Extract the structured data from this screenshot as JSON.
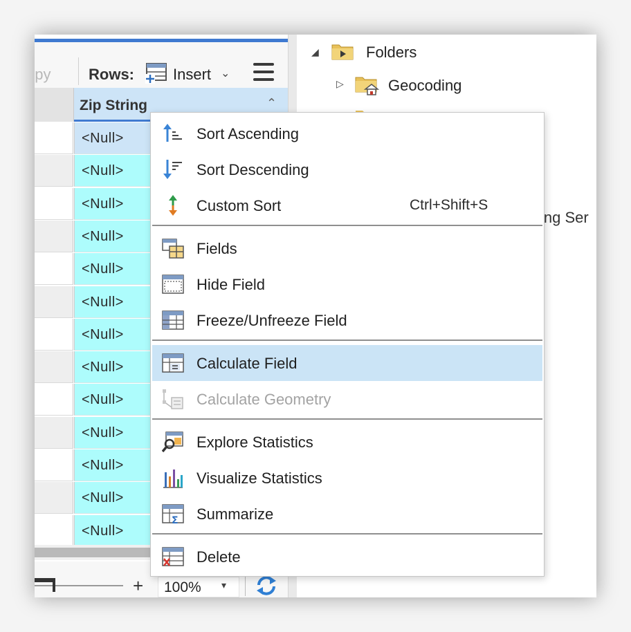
{
  "toolbar": {
    "copy_label": "opy",
    "rows_label": "Rows:",
    "insert_label": "Insert",
    "insert_arrow": "⌄"
  },
  "table": {
    "column_header": "Zip String",
    "header_chevron": "⌃",
    "cells": [
      "<Null>",
      "<Null>",
      "<Null>",
      "<Null>",
      "<Null>",
      "<Null>",
      "<Null>",
      "<Null>",
      "<Null>",
      "<Null>",
      "<Null>",
      "<Null>",
      "<Null>"
    ]
  },
  "zoom": {
    "plus": "+",
    "value": "100%",
    "arrow": "▾"
  },
  "catalog": {
    "expand_folders": "◢",
    "folders_label": "Folders",
    "expand_geocoding": "▷",
    "geocoding_label": "Geocoding",
    "cut_text": "ing Ser"
  },
  "menu": {
    "items": [
      {
        "label": "Sort Ascending",
        "icon": "sort-ascending-icon"
      },
      {
        "label": "Sort Descending",
        "icon": "sort-descending-icon"
      },
      {
        "label": "Custom Sort",
        "shortcut": "Ctrl+Shift+S",
        "icon": "custom-sort-icon"
      },
      {
        "label": "Fields",
        "icon": "fields-icon"
      },
      {
        "label": "Hide Field",
        "icon": "hide-field-icon"
      },
      {
        "label": "Freeze/Unfreeze Field",
        "icon": "freeze-field-icon"
      },
      {
        "label": "Calculate Field",
        "icon": "calculate-field-icon",
        "highlighted": true
      },
      {
        "label": "Calculate Geometry",
        "icon": "calculate-geometry-icon",
        "disabled": true
      },
      {
        "label": "Explore Statistics",
        "icon": "explore-statistics-icon"
      },
      {
        "label": "Visualize Statistics",
        "icon": "visualize-statistics-icon"
      },
      {
        "label": "Summarize",
        "icon": "summarize-icon"
      },
      {
        "label": "Delete",
        "icon": "delete-icon"
      }
    ]
  },
  "colors": {
    "accent": "#3f7ad1",
    "cell_bg": "#adfcfc",
    "selected_cell_bg": "#cde4f7",
    "menu_highlight": "#cbe4f6"
  }
}
